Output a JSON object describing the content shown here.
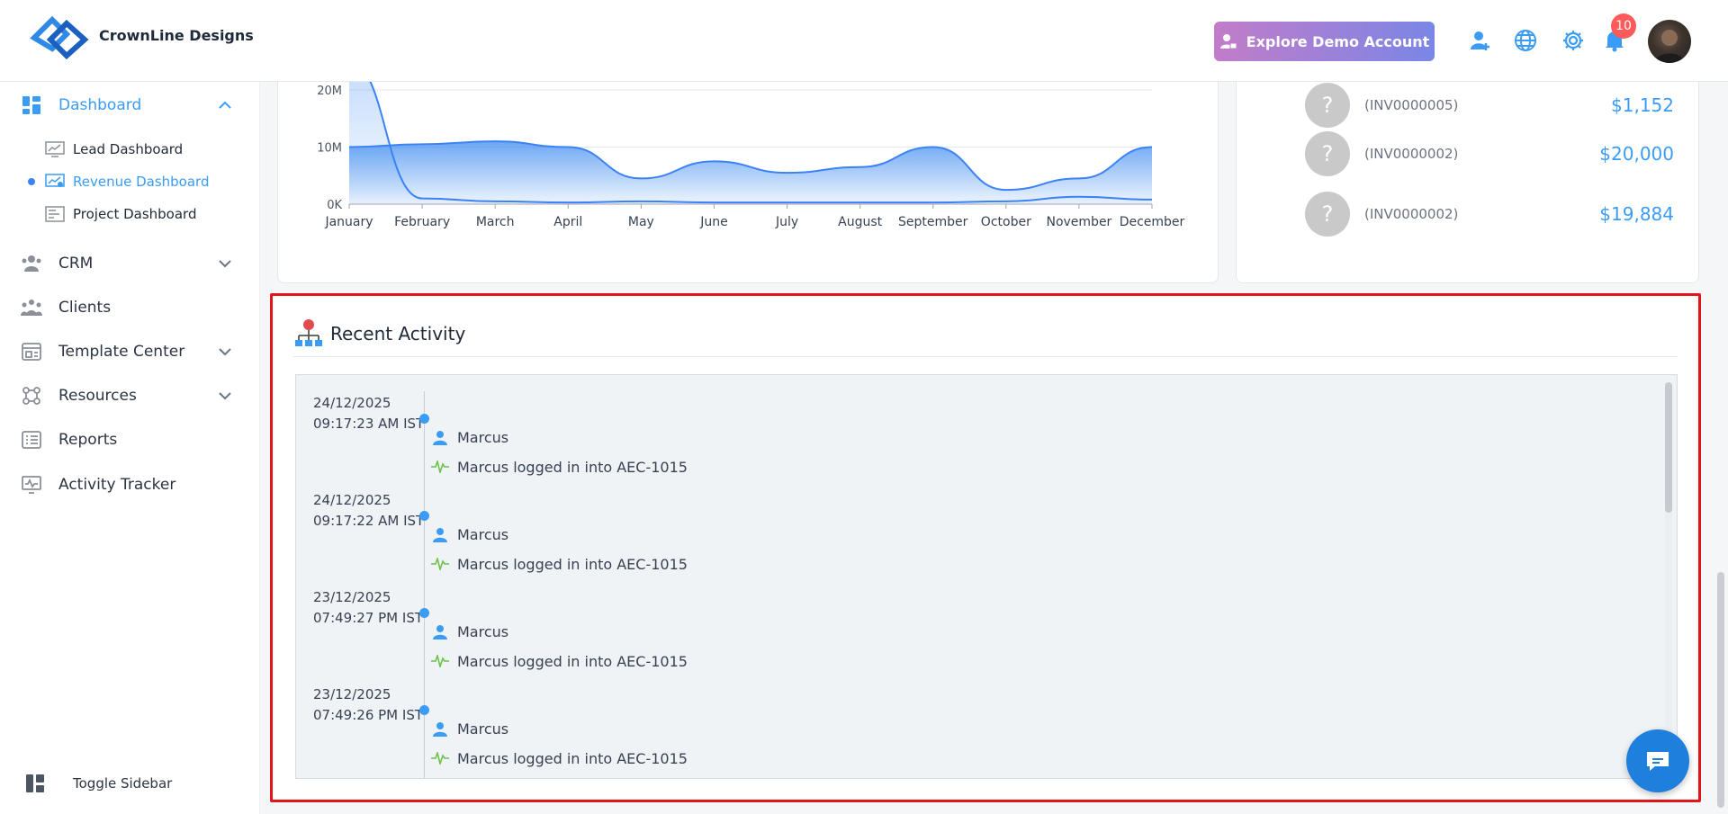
{
  "header": {
    "brand": "CrownLine Designs",
    "demo_button": "Explore Demo Account",
    "notification_count": "10"
  },
  "sidebar": {
    "dashboard": "Dashboard",
    "sub_items": [
      "Lead Dashboard",
      "Revenue Dashboard",
      "Project Dashboard"
    ],
    "crm": "CRM",
    "clients": "Clients",
    "template_center": "Template Center",
    "resources": "Resources",
    "reports": "Reports",
    "activity_tracker": "Activity Tracker",
    "toggle": "Toggle Sidebar"
  },
  "chart_data": {
    "type": "area",
    "categories": [
      "January",
      "February",
      "March",
      "April",
      "May",
      "June",
      "July",
      "August",
      "September",
      "October",
      "November",
      "December"
    ],
    "y_ticks": [
      "0K",
      "10M",
      "20M"
    ],
    "ylim": [
      0,
      22
    ],
    "series": [
      {
        "values": [
          10,
          10.5,
          11,
          10,
          4.5,
          7.5,
          5.5,
          6.5,
          10,
          2.5,
          4.5,
          10
        ]
      },
      {
        "values": [
          25,
          1,
          0.5,
          0.3,
          0.5,
          0.3,
          0.3,
          0.3,
          0.3,
          0.5,
          1.3,
          0.8
        ]
      }
    ],
    "colors": {
      "area": "#3f8cf0",
      "line": "#3b82f6"
    }
  },
  "invoices": [
    {
      "id": "(INV0000005)",
      "amount": "$1,152"
    },
    {
      "id": "(INV0000002)",
      "amount": "$20,000"
    },
    {
      "id": "(INV0000002)",
      "amount": "$19,884"
    }
  ],
  "activity": {
    "title": "Recent Activity",
    "entries": [
      {
        "date": "24/12/2025",
        "time": "09:17:23 AM IST",
        "user": "Marcus",
        "action": "Marcus logged in into AEC-1015"
      },
      {
        "date": "24/12/2025",
        "time": "09:17:22 AM IST",
        "user": "Marcus",
        "action": "Marcus logged in into AEC-1015"
      },
      {
        "date": "23/12/2025",
        "time": "07:49:27 PM IST",
        "user": "Marcus",
        "action": "Marcus logged in into AEC-1015"
      },
      {
        "date": "23/12/2025",
        "time": "07:49:26 PM IST",
        "user": "Marcus",
        "action": "Marcus logged in into AEC-1015"
      }
    ]
  },
  "colors": {
    "accent": "#3b9cf5",
    "highlight_border": "#e3141a"
  }
}
